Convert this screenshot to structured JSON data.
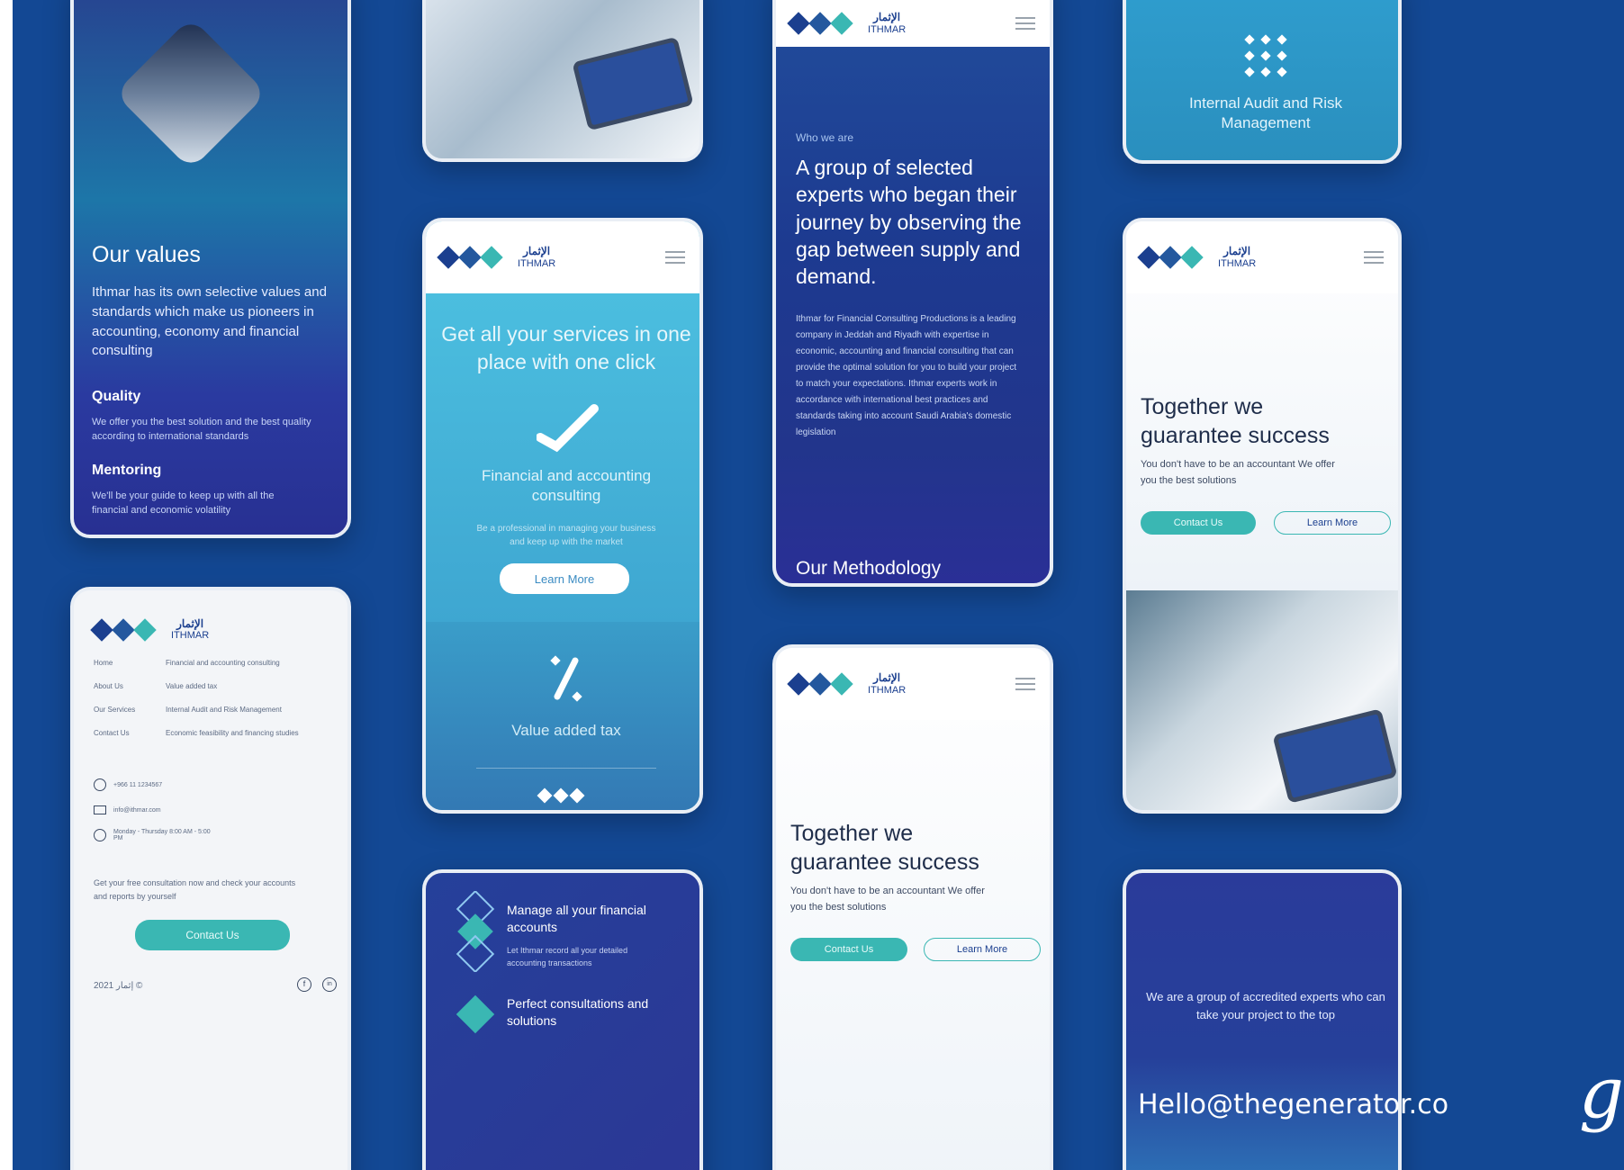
{
  "brand": {
    "name_ar": "الإثمار",
    "name_en": "ITHMAR"
  },
  "values_screen": {
    "title": "Our values",
    "intro": "Ithmar has its own selective values and standards which make us pioneers in accounting, economy and financial consulting",
    "items": [
      {
        "title": "Quality",
        "text": "We offer you the best solution and the best quality according to international standards"
      },
      {
        "title": "Mentoring",
        "text": "We'll be your guide to keep up with all the financial and economic volatility"
      }
    ]
  },
  "services_screen": {
    "headline": "Get all your services in one place with one click",
    "service1_title": "Financial and accounting consulting",
    "service1_text": "Be a professional in managing your business and keep up with the market",
    "learn_more": "Learn More",
    "service2_title": "Value added tax"
  },
  "about_screen": {
    "eyebrow": "Who we are",
    "headline": "A group of selected experts who began their journey by observing the gap between supply and demand.",
    "body": "Ithmar for Financial Consulting Productions is a leading company in Jeddah and Riyadh with expertise in economic, accounting and financial consulting that can provide the optimal solution for you to build your project to match your expectations. Ithmar experts work in accordance with international best practices and standards taking into account Saudi Arabia's domestic legislation",
    "section_title": "Our Methodology"
  },
  "audit_card": {
    "title": "Internal Audit and Risk Management"
  },
  "hero_screen": {
    "headline": "Together we guarantee success",
    "subtext": "You don't have to be an accountant We offer you the best solutions",
    "contact_label": "Contact Us",
    "learn_more": "Learn More"
  },
  "footer_screen": {
    "nav": [
      {
        "label": "Home",
        "desc": "Financial and accounting consulting"
      },
      {
        "label": "About Us",
        "desc": "Value added tax"
      },
      {
        "label": "Our Services",
        "desc": "Internal Audit and Risk Management"
      },
      {
        "label": "Contact Us",
        "desc": "Economic feasibility and financing studies"
      }
    ],
    "contacts": [
      "+966 11 1234567",
      "info@ithmar.com",
      "Monday - Thursday 8:00 AM - 5:00 PM"
    ],
    "cta_text": "Get your free consultation now and check your accounts and reports by yourself",
    "contact_label": "Contact Us",
    "copyright": "إثمار 2021 ©"
  },
  "manage_screen": {
    "item1_title": "Manage all your financial accounts",
    "item1_text": "Let Ithmar record all your detailed accounting transactions",
    "item2_title": "Perfect consultations and solutions"
  },
  "experts_screen": {
    "text": "We are a group of accredited experts who can take your project to the top"
  },
  "credit": "Hello@thegenerator.co",
  "colors": {
    "background": "#134894",
    "teal": "#3ab7b3",
    "navy": "#1b3f8f"
  },
  "icons": [
    "menu-icon",
    "check-icon",
    "percent-icon",
    "whatsapp-icon",
    "mail-icon",
    "clock-icon",
    "facebook-icon",
    "linkedin-icon"
  ]
}
